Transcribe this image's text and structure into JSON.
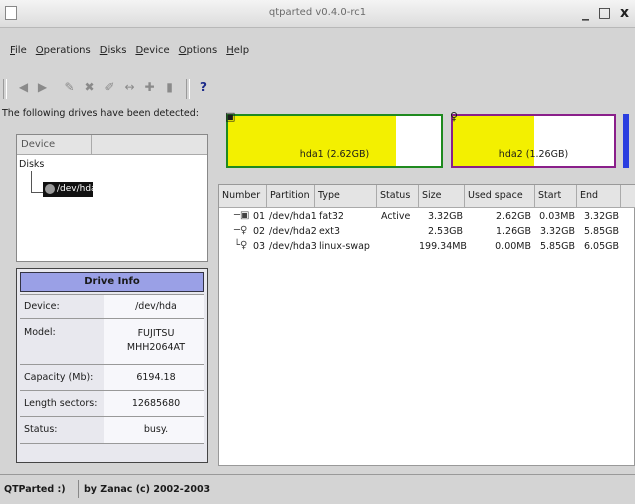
{
  "window": {
    "title": "qtparted v0.4.0-rc1",
    "controls": "_ □ x"
  },
  "menu": [
    "File",
    "Operations",
    "Disks",
    "Device",
    "Options",
    "Help"
  ],
  "toolbar": {
    "icons": [
      "back-icon",
      "forward-icon",
      "resize-icon",
      "delete-icon",
      "edit-icon",
      "move-icon",
      "add-icon",
      "trash-icon",
      "whats-this-icon"
    ],
    "help_glyph": "?"
  },
  "left": {
    "detected_label": "The following drives have been detected:",
    "device_header": "Device",
    "disks_label": "Disks",
    "selected_drive": "/dev/hda"
  },
  "drive_info": {
    "title": "Drive Info",
    "rows": [
      {
        "key": "Device:",
        "value": "/dev/hda"
      },
      {
        "key": "Model:",
        "value": "FUJITSU MHH2064AT"
      },
      {
        "key": "Capacity (Mb):",
        "value": "6194.18"
      },
      {
        "key": "Length sectors:",
        "value": "12685680"
      },
      {
        "key": "Status:",
        "value": "busy."
      }
    ]
  },
  "partition_map": [
    {
      "label": "hda1 (2.62GB)",
      "border": "#1f8a1f",
      "used_fraction": 0.79
    },
    {
      "label": "hda2 (1.26GB)",
      "border": "#8a1f8a",
      "used_fraction": 0.5
    }
  ],
  "table": {
    "columns": [
      "Number",
      "Partition",
      "Type",
      "Status",
      "Size",
      "Used space",
      "Start",
      "End"
    ],
    "rows": [
      {
        "number": "01",
        "partition": "/dev/hda1",
        "type": "fat32",
        "status": "Active",
        "size": "3.32GB",
        "used": "2.62GB",
        "start": "0.03MB",
        "end": "3.32GB"
      },
      {
        "number": "02",
        "partition": "/dev/hda2",
        "type": "ext3",
        "status": "",
        "size": "2.53GB",
        "used": "1.26GB",
        "start": "3.32GB",
        "end": "5.85GB"
      },
      {
        "number": "03",
        "partition": "/dev/hda3",
        "type": "linux-swap",
        "status": "",
        "size": "199.34MB",
        "used": "0.00MB",
        "start": "5.85GB",
        "end": "6.05GB"
      }
    ]
  },
  "status": {
    "app": "QTParted :)",
    "credit": "by Zanac (c) 2002-2003"
  }
}
